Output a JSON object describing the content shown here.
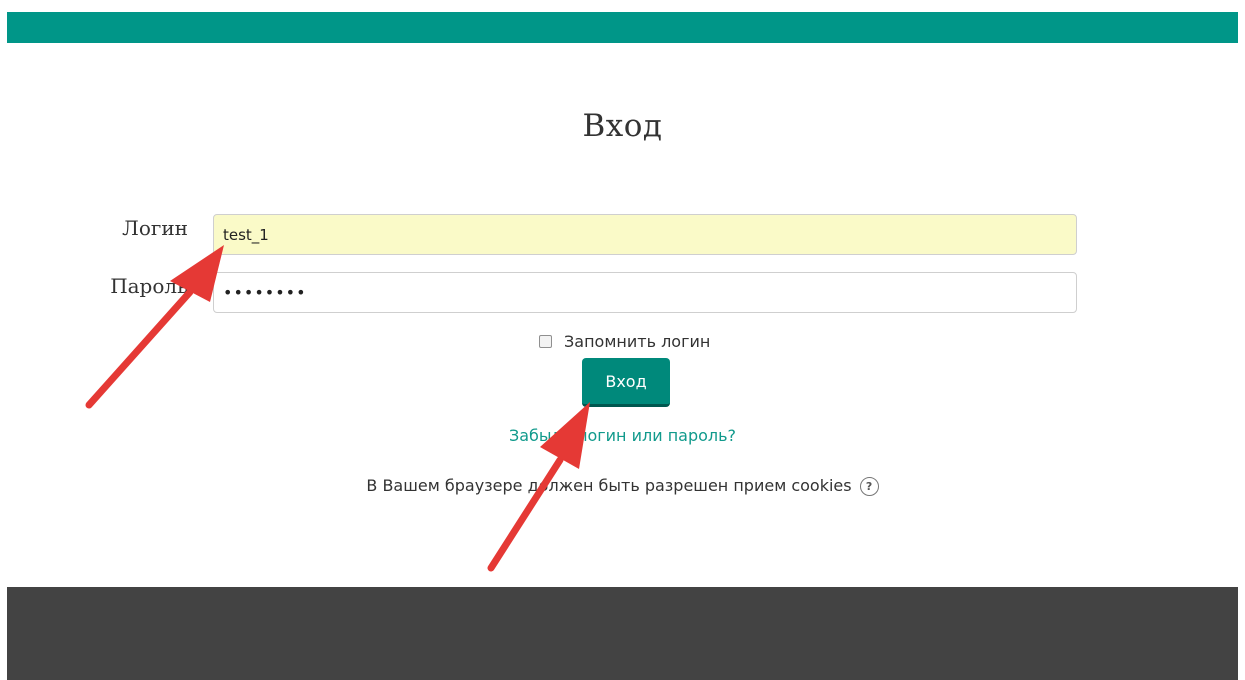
{
  "login_form": {
    "title": "Вход",
    "username_label": "Логин",
    "username_value": "test_1",
    "password_label": "Пароль",
    "password_value": "Test1234",
    "remember_label": "Запомнить логин",
    "remember_checked": false,
    "submit_label": "Вход",
    "forgot_link": "Забыли логин или пароль?",
    "cookies_notice": "В Вашем браузере должен быть разрешен прием cookies",
    "help_icon": "question-circle-icon"
  },
  "colors": {
    "header_bar": "#009688",
    "button": "#00897b",
    "link": "#119a8c",
    "footer": "#434343",
    "autofill_bg": "#fafac8",
    "annotation_arrow": "#e53935"
  }
}
